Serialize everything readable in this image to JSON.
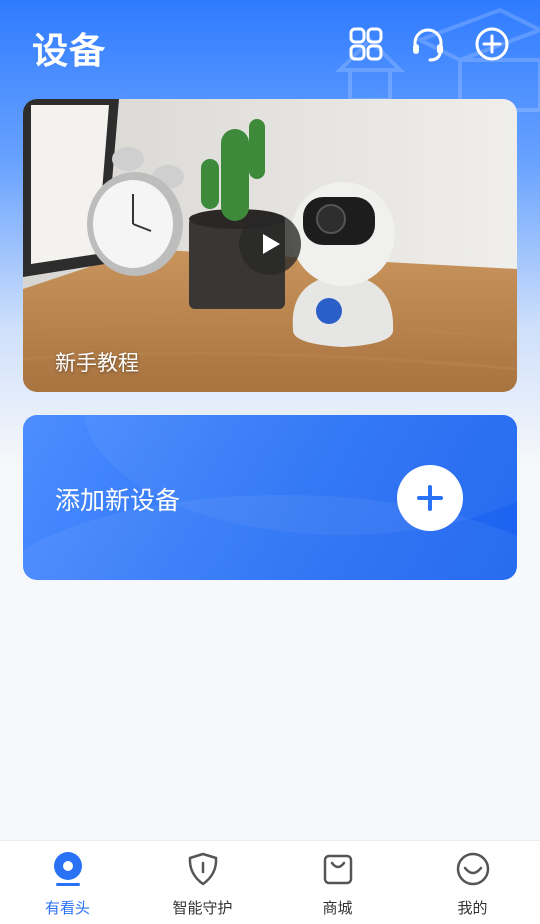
{
  "header": {
    "title": "设备",
    "icons": [
      "grid-icon",
      "headset-icon",
      "add-circle-icon"
    ]
  },
  "tutorial": {
    "label": "新手教程",
    "icon": "play-icon"
  },
  "add_device": {
    "label": "添加新设备",
    "icon": "plus-icon"
  },
  "tabbar": {
    "items": [
      {
        "label": "有看头",
        "icon": "camera-eye-icon",
        "active": true
      },
      {
        "label": "智能守护",
        "icon": "shield-icon",
        "active": false
      },
      {
        "label": "商城",
        "icon": "shopping-bag-icon",
        "active": false
      },
      {
        "label": "我的",
        "icon": "smile-icon",
        "active": false
      }
    ]
  },
  "colors": {
    "accent": "#2a72f5",
    "background": "#f7f8fa"
  }
}
